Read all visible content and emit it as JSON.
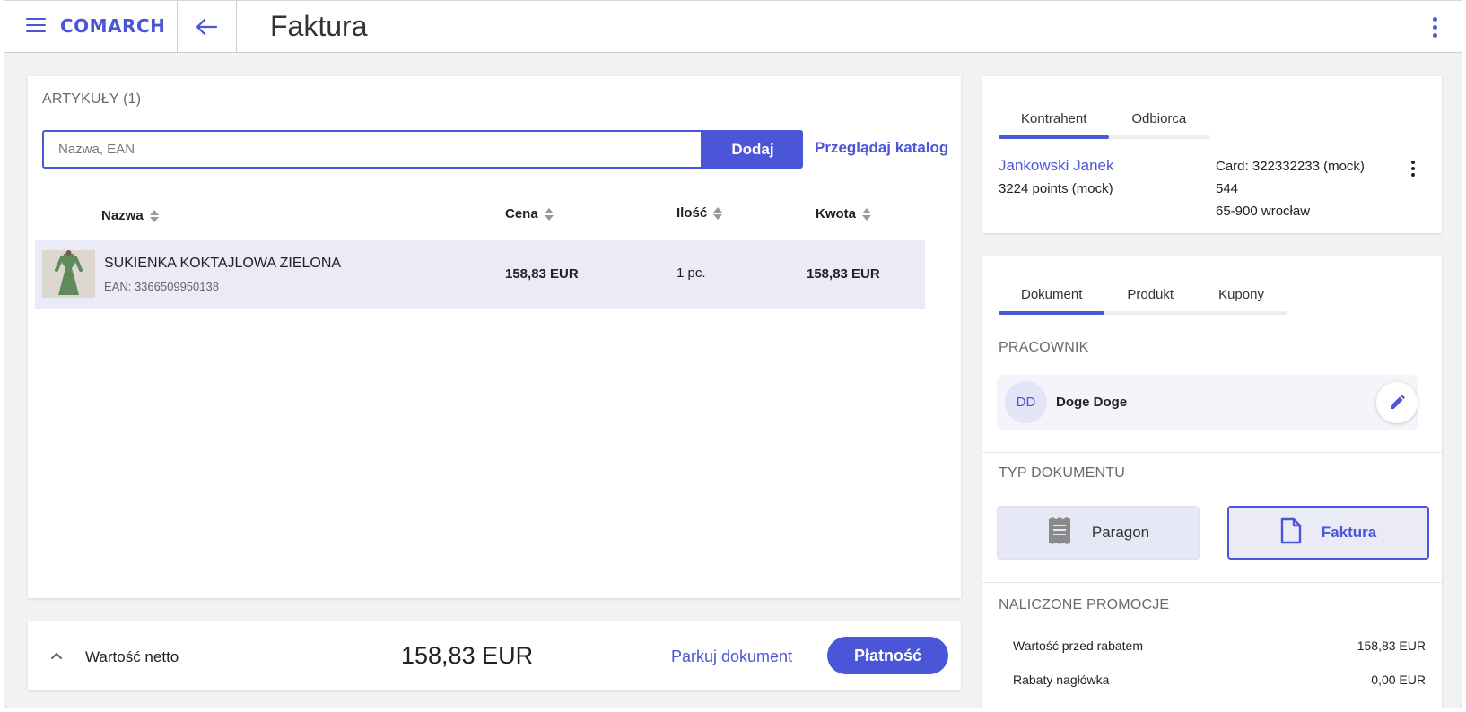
{
  "header": {
    "brand": "COMARCH",
    "title": "Faktura"
  },
  "articles": {
    "caption": "ARTYKUŁY (1)",
    "search_placeholder": "Nazwa, EAN",
    "add_label": "Dodaj",
    "catalog_link": "Przeglądaj katalog",
    "columns": [
      "Nazwa",
      "Cena",
      "Ilość",
      "Kwota"
    ],
    "rows": [
      {
        "name": "SUKIENKA KOKTAJLOWA ZIELONA",
        "ean": "EAN: 3366509950138",
        "price": "158,83 EUR",
        "quantity": "1 pc.",
        "amount": "158,83 EUR"
      }
    ]
  },
  "footer": {
    "net_label": "Wartość netto",
    "net_value": "158,83 EUR",
    "park_label": "Parkuj dokument",
    "pay_label": "Płatność"
  },
  "customer": {
    "tabs": [
      "Kontrahent",
      "Odbiorca"
    ],
    "active_tab": "Kontrahent",
    "name": "Jankowski Janek",
    "points": "3224 points (mock)",
    "card": "Card: 322332233 (mock)",
    "address_line1": "544",
    "address_line2": "65-900 wrocław"
  },
  "document": {
    "tabs": [
      "Dokument",
      "Produkt",
      "Kupony"
    ],
    "active_tab": "Dokument",
    "employee_caption": "PRACOWNIK",
    "employee_initials": "DD",
    "employee_name": "Doge Doge",
    "doc_type_caption": "TYP DOKUMENTU",
    "doc_types": [
      "Paragon",
      "Faktura"
    ],
    "selected_doc_type": "Faktura",
    "promotions_caption": "NALICZONE PROMOCJE",
    "promotions": [
      {
        "label": "Wartość przed rabatem",
        "value": "158,83 EUR"
      },
      {
        "label": "Rabaty nagłówka",
        "value": "0,00 EUR"
      }
    ]
  },
  "colors": {
    "accent": "#4a55d8",
    "selected_row": "#ebebf8",
    "background": "#f2f2f2"
  },
  "icons": [
    "menu-icon",
    "arrow-left-icon",
    "more-vert-icon",
    "sort-icon",
    "chevron-up-icon",
    "pencil-icon",
    "receipt-icon",
    "document-icon"
  ]
}
